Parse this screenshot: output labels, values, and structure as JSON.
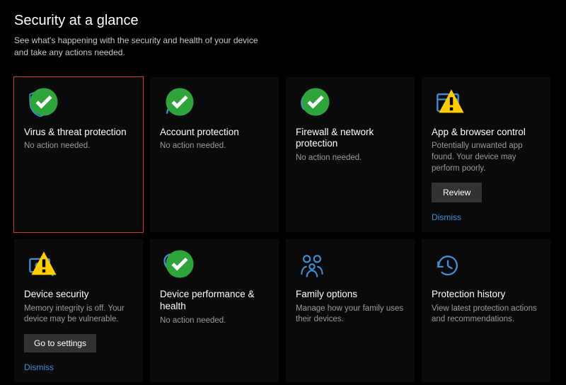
{
  "header": {
    "title": "Security at a glance",
    "subtitle": "See what's happening with the security and health of your device and take any actions needed."
  },
  "tiles": {
    "virus": {
      "title": "Virus & threat protection",
      "desc": "No action needed."
    },
    "account": {
      "title": "Account protection",
      "desc": "No action needed."
    },
    "firewall": {
      "title": "Firewall & network protection",
      "desc": "No action needed."
    },
    "app": {
      "title": "App & browser control",
      "desc": "Potentially unwanted app found. Your device may perform poorly.",
      "button": "Review",
      "link": "Dismiss"
    },
    "device": {
      "title": "Device security",
      "desc": "Memory integrity is off. Your device may be vulnerable.",
      "button": "Go to settings",
      "link": "Dismiss"
    },
    "perf": {
      "title": "Device performance & health",
      "desc": "No action needed."
    },
    "family": {
      "title": "Family options",
      "desc": "Manage how your family uses their devices."
    },
    "history": {
      "title": "Protection history",
      "desc": "View latest protection actions and recommendations."
    }
  },
  "colors": {
    "accent": "#3e90d8",
    "ok": "#2fa43a",
    "warn": "#ffcc00"
  }
}
